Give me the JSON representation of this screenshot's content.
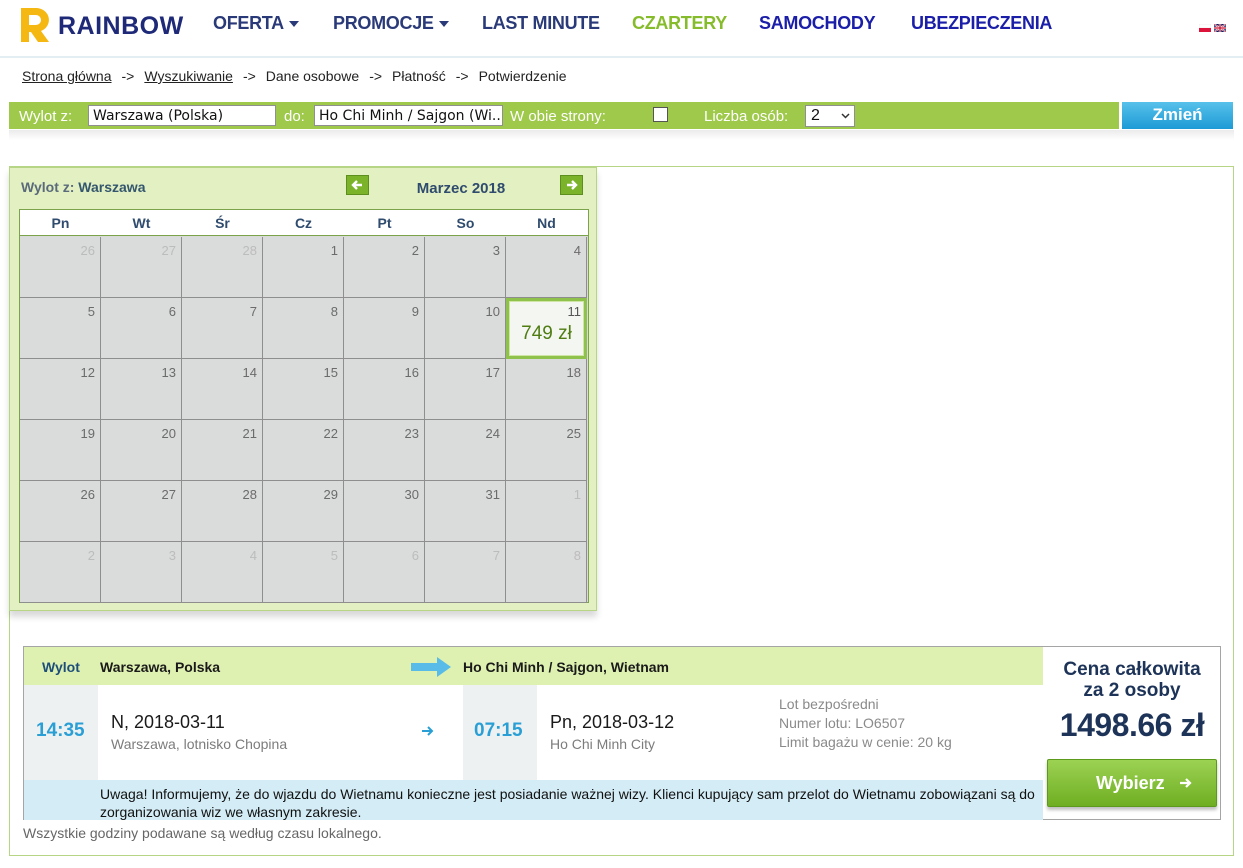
{
  "brand": {
    "name": "RAINBOW",
    "accent": "#f5b812",
    "navy": "#1e2a78",
    "green": "#9ec94a"
  },
  "nav": {
    "oferta": "OFERTA",
    "promocje": "PROMOCJE",
    "last_minute": "LAST MINUTE",
    "czartery": "CZARTERY",
    "samochody": "SAMOCHODY",
    "ubezpieczenia": "UBEZPIECZENIA"
  },
  "breadcrumb": {
    "home": "Strona główna",
    "search": "Wyszukiwanie",
    "personal": "Dane osobowe",
    "payment": "Płatność",
    "confirm": "Potwierdzenie",
    "sep": "->"
  },
  "search": {
    "from_label": "Wylot z:",
    "from_value": "Warszawa (Polska)",
    "to_label": "do:",
    "to_value": "Ho Chi Minh / Sajgon (Wi...",
    "both_ways_label": "W obie strony:",
    "both_ways_checked": false,
    "persons_label": "Liczba osób:",
    "persons_value": "2",
    "change_button": "Zmień"
  },
  "calendar": {
    "from_label": "Wylot z:",
    "from_city": "Warszawa",
    "month": "Marzec 2018",
    "weekdays": [
      "Pn",
      "Wt",
      "Śr",
      "Cz",
      "Pt",
      "So",
      "Nd"
    ],
    "days": [
      "26",
      "27",
      "28",
      "1",
      "2",
      "3",
      "4",
      "5",
      "6",
      "7",
      "8",
      "9",
      "10",
      "11",
      "12",
      "13",
      "14",
      "15",
      "16",
      "17",
      "18",
      "19",
      "20",
      "21",
      "22",
      "23",
      "24",
      "25",
      "26",
      "27",
      "28",
      "29",
      "30",
      "31",
      "1",
      "2",
      "3",
      "4",
      "5",
      "6",
      "7",
      "8"
    ],
    "price_day": "11",
    "price": "749 zł"
  },
  "flight": {
    "header_label": "Wylot",
    "from": "Warszawa, Polska",
    "to": "Ho Chi Minh / Sajgon, Wietnam",
    "depart_time": "14:35",
    "depart_date": "N, 2018-03-11",
    "depart_place": "Warszawa, lotnisko Chopina",
    "arrive_time": "07:15",
    "arrive_date": "Pn, 2018-03-12",
    "arrive_place": "Ho Chi Minh City",
    "direct": "Lot bezpośredni",
    "flight_number": "Numer lotu: LO6507",
    "baggage": "Limit bagażu w cenie: 20 kg",
    "notice": "Uwaga! Informujemy, że do wjazdu do Wietnamu konieczne jest posiadanie ważnej wizy. Klienci kupujący sam przelot do Wietnamu zobowiązani są do zorganizowania wiz we własnym zakresie."
  },
  "price": {
    "title_line1": "Cena całkowita",
    "title_line2": "za 2 osoby",
    "total": "1498.66 zł",
    "select_button": "Wybierz"
  },
  "footer_note": "Wszystkie godziny podawane są według czasu lokalnego."
}
